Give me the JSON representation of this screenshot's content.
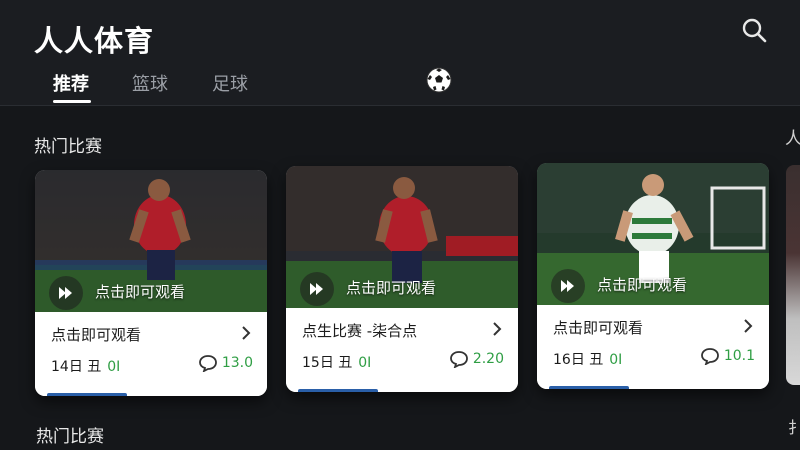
{
  "app": {
    "title": "人人体育"
  },
  "header": {
    "tabs": [
      {
        "label": "推荐",
        "active": true
      },
      {
        "label": "篮球",
        "active": false
      },
      {
        "label": "足球",
        "active": false
      }
    ],
    "icons": {
      "search": "search-icon",
      "ball": "soccer-ball-icon"
    }
  },
  "sections": [
    {
      "title": "热门比赛"
    },
    {
      "title": "热门比赛"
    }
  ],
  "peek": {
    "top_char": "人",
    "bottom_char": "扌"
  },
  "cards": [
    {
      "play_label": "点击即可观看",
      "title": "点击即可观看",
      "date": "14日 丑",
      "status": "0I",
      "odds": "13.0",
      "jersey": "#b01e2a",
      "icons": {
        "play": "play-icon",
        "chevron": "chevron-right-icon",
        "odds": "chat-bubble-icon"
      }
    },
    {
      "play_label": "点击即可观看",
      "title": "点生比赛 -柒合点",
      "date": "15日 丑",
      "status": "0I",
      "odds": "2.20",
      "jersey": "#b01e2a",
      "icons": {
        "play": "play-icon",
        "chevron": "chevron-right-icon",
        "odds": "chat-bubble-icon"
      }
    },
    {
      "play_label": "点击即可观看",
      "title": "点击即可观看",
      "date": "16日 丑",
      "status": "0I",
      "odds": "10.1",
      "jersey": "#e9efe9",
      "icons": {
        "play": "play-icon",
        "chevron": "chevron-right-icon",
        "odds": "chat-bubble-icon"
      }
    }
  ],
  "colors": {
    "background": "#15171a",
    "accent_green": "#2f9e44",
    "card": "#ffffff"
  }
}
